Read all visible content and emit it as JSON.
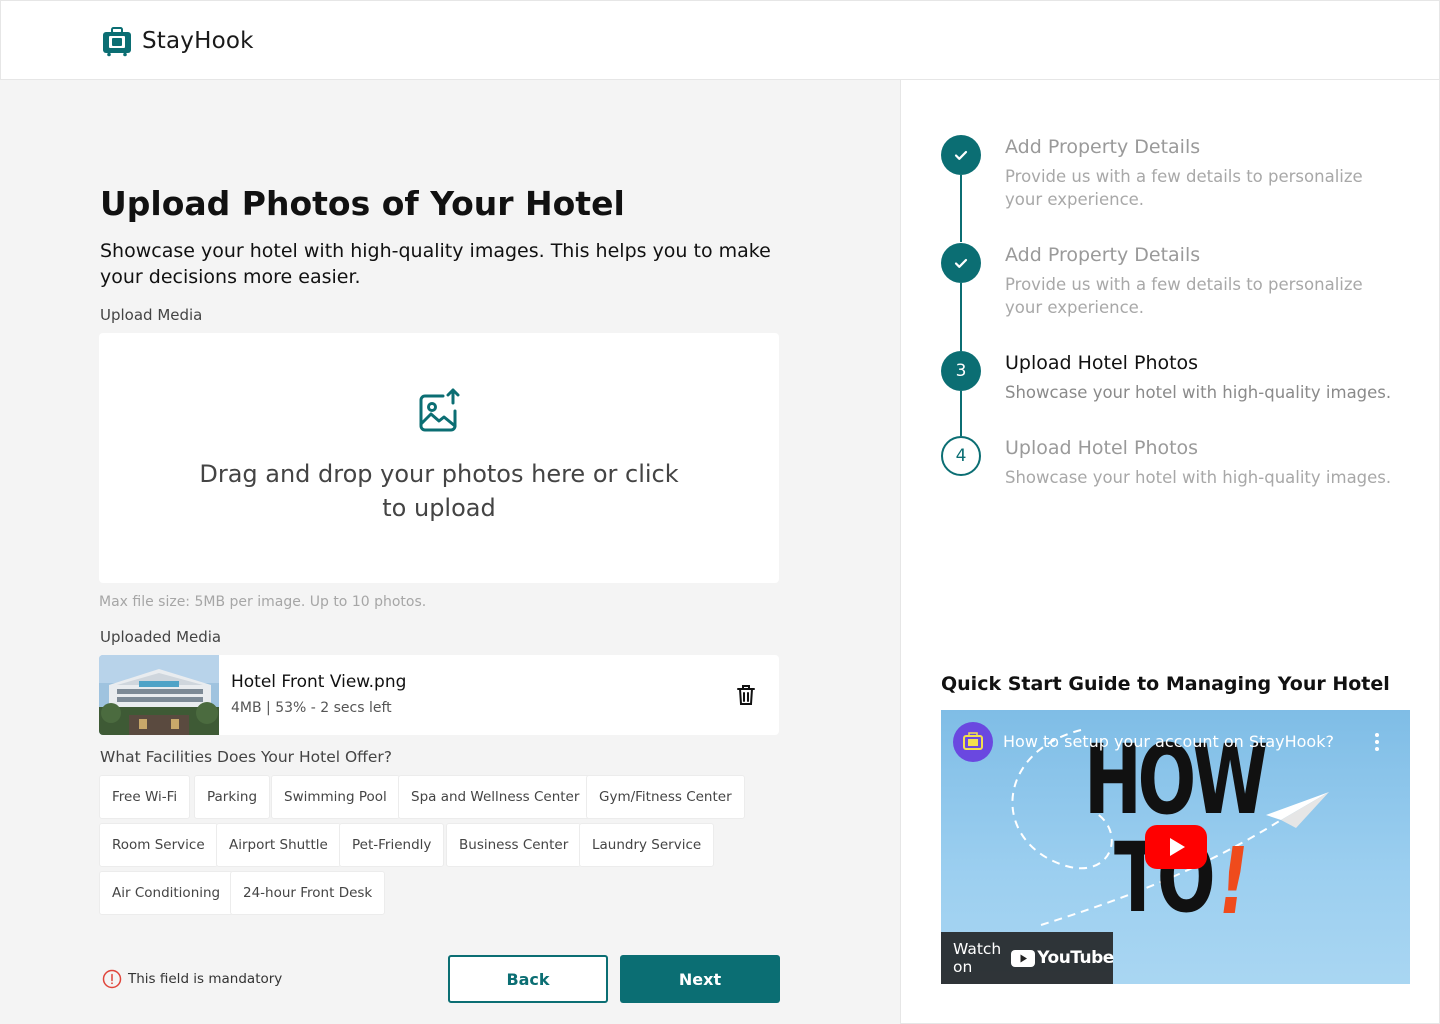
{
  "brand": {
    "name": "StayHook",
    "accent": "#0b6e73"
  },
  "main": {
    "title": "Upload Photos of Your Hotel",
    "subtitle": "Showcase your hotel with high-quality images. This helps you to make your decisions more easier.",
    "upload_label": "Upload Media",
    "drop_text": "Drag and drop your photos here or click to upload",
    "hint": "Max file size: 5MB per image. Up to 10 photos.",
    "uploaded_label": "Uploaded Media",
    "file": {
      "name": "Hotel Front View.png",
      "meta": "4MB | 53% - 2 secs left",
      "progress_percent": 53
    },
    "facilities_label": "What Facilities Does Your Hotel Offer?",
    "facilities": [
      "Free Wi-Fi",
      "Parking",
      "Swimming Pool",
      "Spa and Wellness Center",
      "Gym/Fitness Center",
      "Room Service",
      "Airport Shuttle",
      "Pet-Friendly",
      "Business Center",
      "Laundry Service",
      "Air Conditioning",
      "24-hour Front Desk"
    ],
    "mandatory_text": "This field is mandatory",
    "back_label": "Back",
    "next_label": "Next"
  },
  "steps": [
    {
      "status": "done",
      "marker": "",
      "title": "Add Property Details",
      "desc": "Provide us with a few details to personalize your experience."
    },
    {
      "status": "done",
      "marker": "",
      "title": "Add Property Details",
      "desc": "Provide us with a few details to personalize your experience."
    },
    {
      "status": "active",
      "marker": "3",
      "title": "Upload Hotel Photos",
      "desc": "Showcase your hotel with high-quality images."
    },
    {
      "status": "pending",
      "marker": "4",
      "title": "Upload Hotel Photos",
      "desc": "Showcase your hotel with high-quality images."
    }
  ],
  "guide": {
    "title": "Quick Start Guide to Managing Your Hotel",
    "video_title": "How to setup your account on StayHook?",
    "thumb_line1": "HOW",
    "thumb_line2": "TO",
    "thumb_exclaim": "!",
    "watch_on": "Watch on",
    "youtube": "YouTube"
  }
}
